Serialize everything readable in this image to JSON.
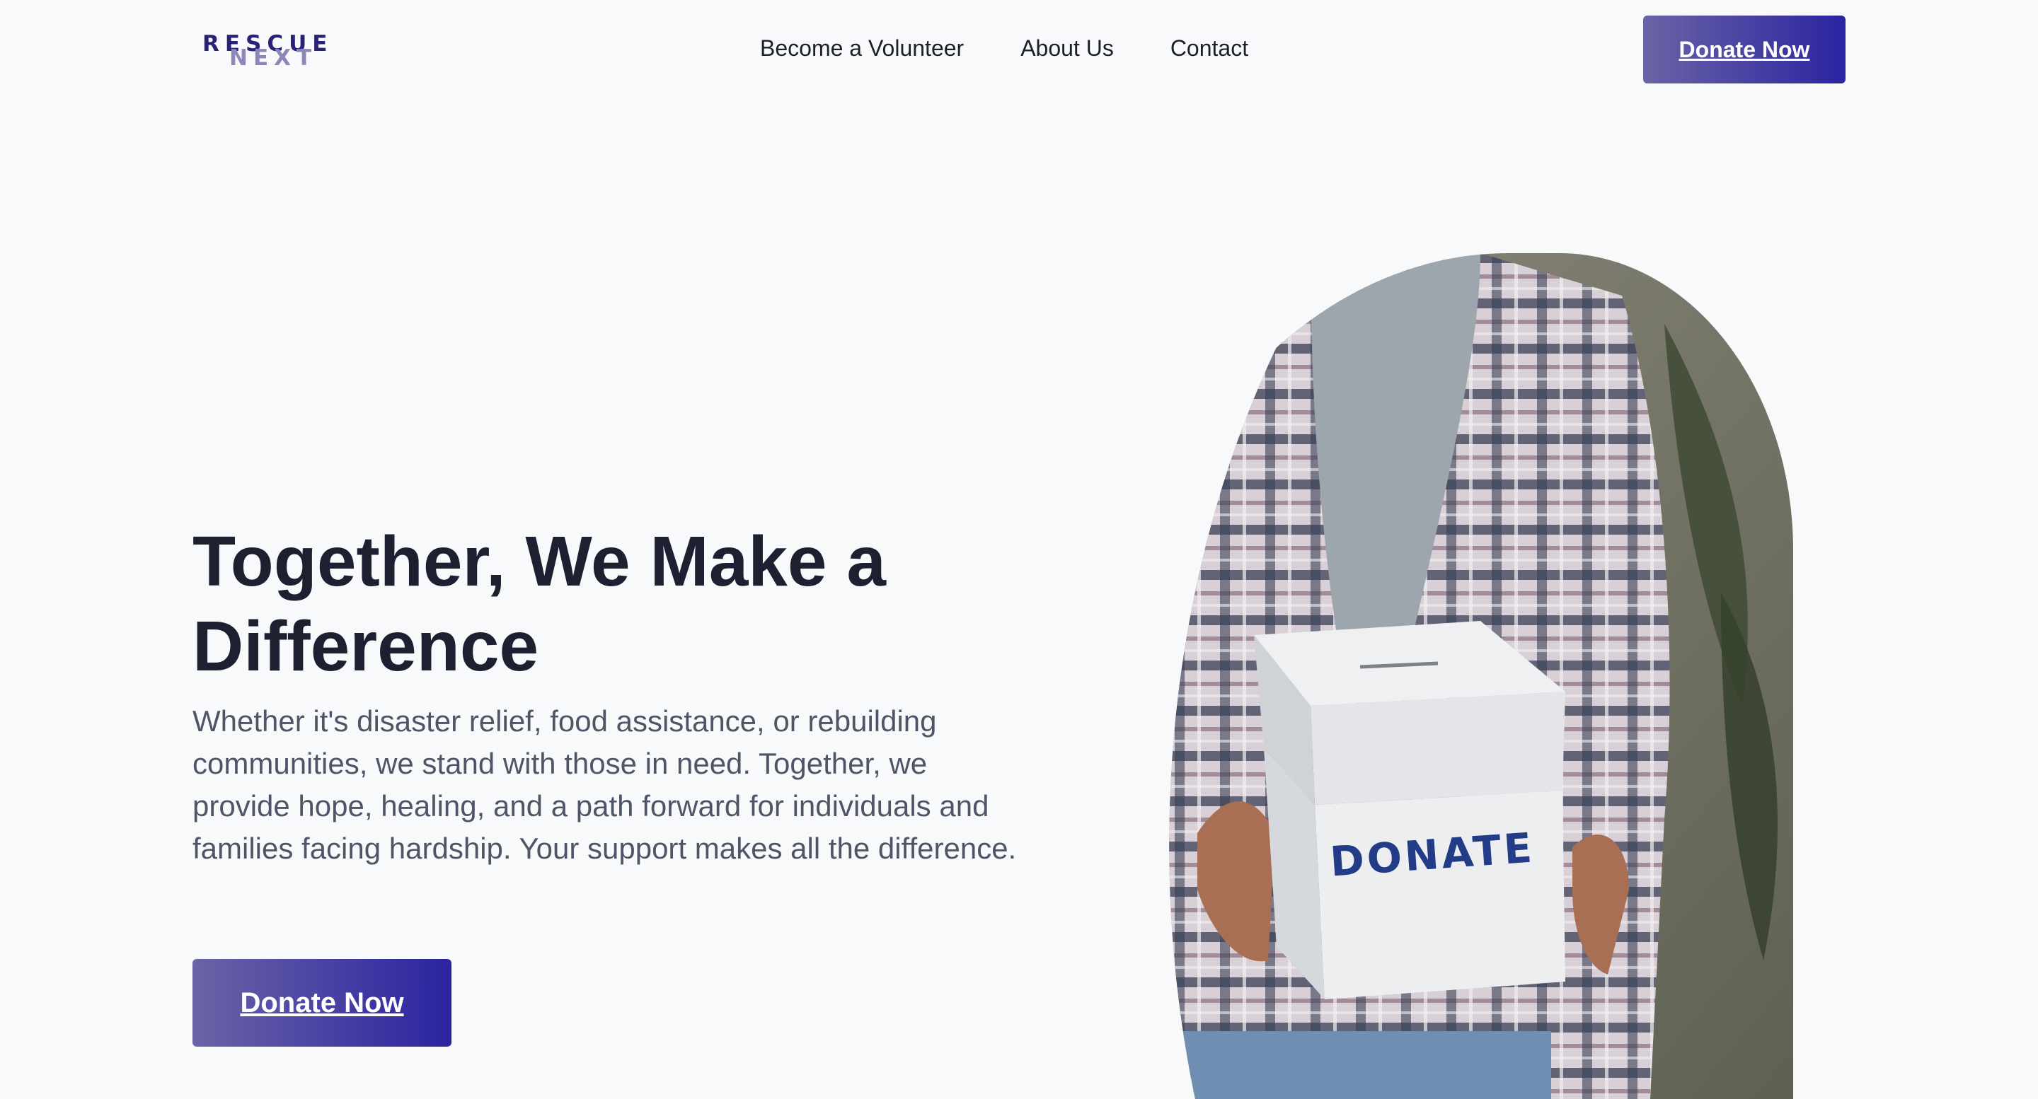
{
  "header": {
    "logo": {
      "line1": "RESCUE",
      "line2": "NEXT"
    },
    "nav": [
      {
        "label": "Become a Volunteer"
      },
      {
        "label": "About Us"
      },
      {
        "label": "Contact"
      }
    ],
    "cta_label": "Donate Now"
  },
  "hero": {
    "title": "Together, We Make a Difference",
    "description": "Whether it's disaster relief, food assistance, or rebuilding communities, we stand with those in need. Together, we provide hope, healing, and a path forward for individuals and families facing hardship. Your support makes all the difference.",
    "cta_label": "Donate Now",
    "image": {
      "box_label": "DONATE"
    }
  },
  "colors": {
    "brand_dark": "#2b23a0",
    "brand_light": "#6a64a6",
    "heading": "#1d2030",
    "body_text": "#4e5566",
    "background": "#f8f9fb"
  }
}
